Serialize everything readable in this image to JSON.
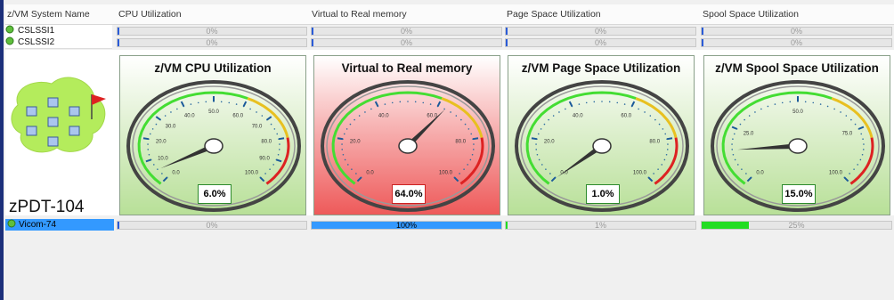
{
  "columns": [
    "z/VM System Name",
    "CPU Utilization",
    "Virtual to Real memory",
    "Page Space Utilization",
    "Spool Space Utilization"
  ],
  "systems": [
    {
      "name": "CSLSSI1",
      "cpu": "0%",
      "v2r": "0%",
      "page": "0%",
      "spool": "0%"
    },
    {
      "name": "CSLSSI2",
      "cpu": "0%",
      "v2r": "0%",
      "page": "0%",
      "spool": "0%"
    }
  ],
  "node": {
    "label": "zPDT-104"
  },
  "gauges": [
    {
      "title": "z/VM CPU Utilization",
      "value_text": "6.0%",
      "value": 6.0,
      "max": 100,
      "scheme": "green",
      "ticks": [
        "0.0",
        "10.0",
        "20.0",
        "30.0",
        "40.0",
        "50.0",
        "60.0",
        "70.0",
        "80.0",
        "90.0",
        "100.0"
      ]
    },
    {
      "title": "Virtual to Real memory",
      "value_text": "64.0%",
      "value": 64.0,
      "max": 100,
      "scheme": "red",
      "ticks": [
        "0.0",
        "20.0",
        "40.0",
        "60.0",
        "80.0",
        "100.0"
      ]
    },
    {
      "title": "z/VM Page Space Utilization",
      "value_text": "1.0%",
      "value": 1.0,
      "max": 100,
      "scheme": "green",
      "ticks": [
        "0.0",
        "20.0",
        "40.0",
        "60.0",
        "80.0",
        "100.0"
      ]
    },
    {
      "title": "z/VM Spool Space Utilization",
      "value_text": "15.0%",
      "value": 15.0,
      "max": 100,
      "scheme": "green",
      "ticks": [
        "0.0",
        "25.0",
        "50.0",
        "75.0",
        "100.0"
      ]
    }
  ],
  "vicom": {
    "name": "Vicom-74",
    "cpu": "0%",
    "cpu_value": 0,
    "v2r": "100%",
    "v2r_value": 100,
    "page": "1%",
    "page_value": 1,
    "spool": "25%",
    "spool_value": 25
  },
  "colors": {
    "accent": "#3399ff",
    "good": "#22dd22",
    "bad": "#ee5a5a"
  }
}
